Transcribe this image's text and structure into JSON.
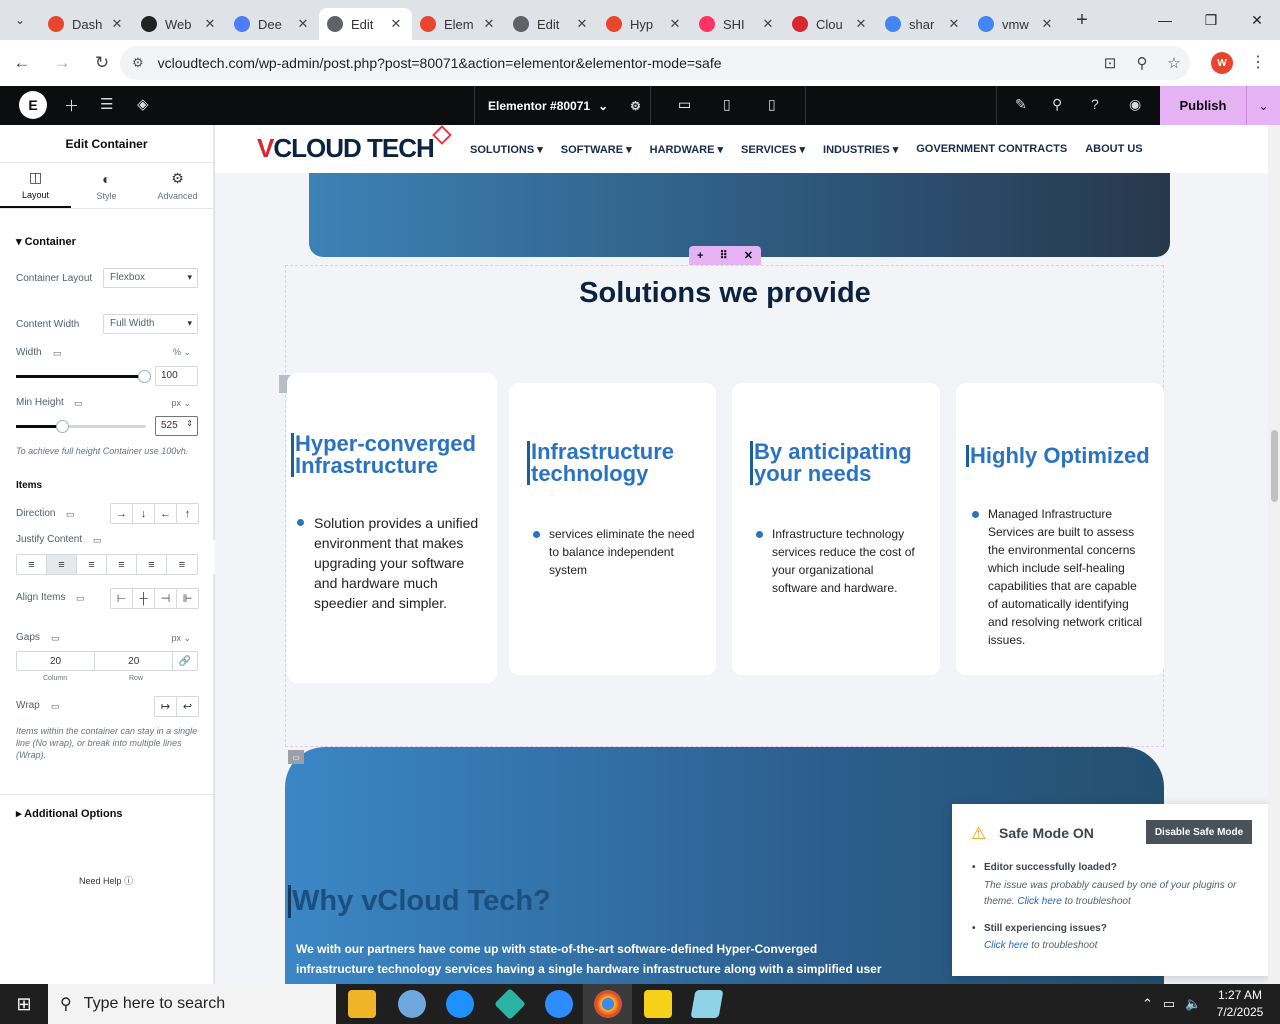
{
  "browser": {
    "tabs": [
      {
        "title": "Dash",
        "color": "#e8452c"
      },
      {
        "title": "Web",
        "color": "#222222"
      },
      {
        "title": "Dee",
        "color": "#4f7cf7"
      },
      {
        "title": "Edit",
        "color": "#5f6368"
      },
      {
        "title": "Elem",
        "color": "#e8452c"
      },
      {
        "title": "Edit",
        "color": "#5f6368"
      },
      {
        "title": "Hyp",
        "color": "#e8452c"
      },
      {
        "title": "SHI",
        "color": "#ff3366"
      },
      {
        "title": "Clou",
        "color": "#d9262f"
      },
      {
        "title": "shar",
        "color": "#4285f4"
      },
      {
        "title": "vmw",
        "color": "#4285f4"
      }
    ],
    "active_tab_index": 3,
    "url": "vcloudtech.com/wp-admin/post.php?post=80071&action=elementor&elementor-mode=safe",
    "profile_initial": "W"
  },
  "elementor": {
    "doc_title": "Elementor #80071",
    "publish_label": "Publish"
  },
  "panel": {
    "title": "Edit Container",
    "tabs": [
      "Layout",
      "Style",
      "Advanced"
    ],
    "section_container": "Container",
    "container_layout_label": "Container Layout",
    "container_layout_value": "Flexbox",
    "content_width_label": "Content Width",
    "content_width_value": "Full Width",
    "width_label": "Width",
    "width_unit": "%",
    "width_value": "100",
    "min_height_label": "Min Height",
    "min_height_unit": "px",
    "min_height_value": "525",
    "min_height_hint": "To achieve full height Container use 100vh.",
    "items_label": "Items",
    "direction_label": "Direction",
    "justify_label": "Justify Content",
    "align_label": "Align Items",
    "gaps_label": "Gaps",
    "gaps_unit": "px",
    "gap_column": "20",
    "gap_row": "20",
    "gap_column_label": "Column",
    "gap_row_label": "Row",
    "wrap_label": "Wrap",
    "wrap_hint": "Items within the container can stay in a single line (No wrap), or break into multiple lines (Wrap).",
    "additional_options": "Additional Options",
    "need_help": "Need Help"
  },
  "site": {
    "logo_text_v": "V",
    "logo_text_rest": "CLOUD TECH",
    "menu": [
      "SOLUTIONS ▾",
      "SOFTWARE ▾",
      "HARDWARE ▾",
      "SERVICES ▾",
      "INDUSTRIES ▾",
      "GOVERNMENT CONTRACTS",
      "ABOUT US"
    ],
    "solutions_title": "Solutions we provide",
    "cards": [
      {
        "title": "Hyper-converged Infrastructure",
        "text": "Solution provides a unified environment that makes upgrading your software and hardware much speedier and simpler."
      },
      {
        "title": "Infrastructure technology",
        "text": "services eliminate the need to balance independent system"
      },
      {
        "title": "By anticipating your needs",
        "text": "Infrastructure technology services reduce the cost of your organizational software and hardware."
      },
      {
        "title": "Highly Optimized",
        "text": "Managed Infrastructure Services are built to assess the environmental concerns which include self-healing capabilities that are capable of automatically identifying and resolving network critical issues."
      }
    ],
    "why_title": "Why vCloud Tech?",
    "why_text": "We with our partners have come up with state-of-the-art software-defined Hyper-Converged infrastructure technology services having a single hardware infrastructure along with a simplified user"
  },
  "safe_mode": {
    "title": "Safe Mode ON",
    "disable_label": "Disable Safe Mode",
    "q1": "Editor successfully loaded?",
    "a1_pre": "The issue was probably caused by one of your plugins or theme.",
    "a1_link": "Click here",
    "a1_post": "to troubleshoot",
    "q2": "Still experiencing issues?",
    "a2_link": "Click here",
    "a2_post": "to troubleshoot"
  },
  "taskbar": {
    "search_placeholder": "Type here to search",
    "time": "1:27 AM",
    "date": "7/2/2025"
  }
}
